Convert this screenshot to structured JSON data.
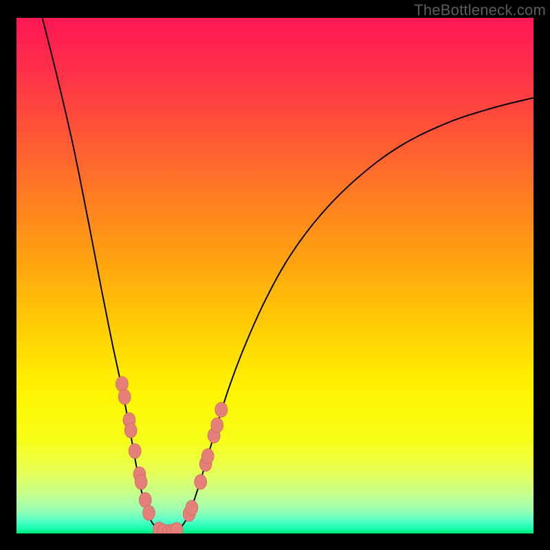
{
  "watermark": "TheBottleneck.com",
  "colors": {
    "frame": "#000000",
    "gradient_stops": [
      {
        "offset": 0.0,
        "color": "#ff1754"
      },
      {
        "offset": 0.1,
        "color": "#ff2f4a"
      },
      {
        "offset": 0.22,
        "color": "#ff5436"
      },
      {
        "offset": 0.35,
        "color": "#ff7e22"
      },
      {
        "offset": 0.48,
        "color": "#ffa60e"
      },
      {
        "offset": 0.6,
        "color": "#ffce04"
      },
      {
        "offset": 0.72,
        "color": "#fff300"
      },
      {
        "offset": 0.82,
        "color": "#f7ff18"
      },
      {
        "offset": 0.88,
        "color": "#e6ff55"
      },
      {
        "offset": 0.92,
        "color": "#c9ff8a"
      },
      {
        "offset": 0.955,
        "color": "#9affb2"
      },
      {
        "offset": 0.975,
        "color": "#58ffc9"
      },
      {
        "offset": 0.99,
        "color": "#18ffb0"
      },
      {
        "offset": 1.0,
        "color": "#00e876"
      }
    ],
    "curve": "#000000",
    "marker_fill": "#e48079",
    "marker_stroke": "#c95e56"
  },
  "chart_data": {
    "type": "line",
    "title": "",
    "xlabel": "",
    "ylabel": "",
    "xlim": [
      0,
      100
    ],
    "ylim": [
      0,
      100
    ],
    "grid": false,
    "legend": false,
    "note": "V-shaped bottleneck curve. Axis values are normalized 0–100 read off the plotting area; original axes are unlabeled.",
    "series": [
      {
        "name": "bottleneck-curve",
        "points": [
          {
            "x": 5.0,
            "y": 100.0
          },
          {
            "x": 8.0,
            "y": 88.0
          },
          {
            "x": 11.0,
            "y": 75.0
          },
          {
            "x": 14.0,
            "y": 60.0
          },
          {
            "x": 16.5,
            "y": 47.0
          },
          {
            "x": 18.5,
            "y": 37.0
          },
          {
            "x": 20.0,
            "y": 30.0
          },
          {
            "x": 21.2,
            "y": 24.0
          },
          {
            "x": 22.3,
            "y": 18.0
          },
          {
            "x": 23.2,
            "y": 13.0
          },
          {
            "x": 24.0,
            "y": 9.0
          },
          {
            "x": 25.0,
            "y": 5.0
          },
          {
            "x": 26.0,
            "y": 2.5
          },
          {
            "x": 27.2,
            "y": 1.0
          },
          {
            "x": 28.6,
            "y": 0.3
          },
          {
            "x": 30.2,
            "y": 0.3
          },
          {
            "x": 31.6,
            "y": 1.0
          },
          {
            "x": 33.0,
            "y": 3.0
          },
          {
            "x": 34.2,
            "y": 6.0
          },
          {
            "x": 35.5,
            "y": 10.0
          },
          {
            "x": 37.0,
            "y": 15.0
          },
          {
            "x": 38.8,
            "y": 21.0
          },
          {
            "x": 41.0,
            "y": 28.0
          },
          {
            "x": 44.0,
            "y": 36.0
          },
          {
            "x": 48.0,
            "y": 45.0
          },
          {
            "x": 53.0,
            "y": 54.0
          },
          {
            "x": 59.0,
            "y": 62.0
          },
          {
            "x": 66.0,
            "y": 69.0
          },
          {
            "x": 74.0,
            "y": 75.0
          },
          {
            "x": 83.0,
            "y": 79.5
          },
          {
            "x": 92.0,
            "y": 82.5
          },
          {
            "x": 100.0,
            "y": 84.5
          }
        ]
      }
    ],
    "markers": {
      "name": "highlighted-points",
      "note": "Salmon dots clustered near the V trough and lower arms.",
      "points": [
        {
          "x": 20.4,
          "y": 29.0
        },
        {
          "x": 20.9,
          "y": 26.5
        },
        {
          "x": 21.8,
          "y": 22.0
        },
        {
          "x": 22.1,
          "y": 20.0
        },
        {
          "x": 22.9,
          "y": 16.0
        },
        {
          "x": 23.8,
          "y": 11.5
        },
        {
          "x": 24.1,
          "y": 10.0
        },
        {
          "x": 24.9,
          "y": 6.5
        },
        {
          "x": 25.6,
          "y": 4.0
        },
        {
          "x": 27.6,
          "y": 0.8
        },
        {
          "x": 28.4,
          "y": 0.4
        },
        {
          "x": 29.4,
          "y": 0.3
        },
        {
          "x": 30.2,
          "y": 0.4
        },
        {
          "x": 31.0,
          "y": 0.7
        },
        {
          "x": 33.4,
          "y": 3.8
        },
        {
          "x": 33.9,
          "y": 5.0
        },
        {
          "x": 35.6,
          "y": 10.0
        },
        {
          "x": 36.6,
          "y": 13.5
        },
        {
          "x": 37.0,
          "y": 15.0
        },
        {
          "x": 38.2,
          "y": 19.0
        },
        {
          "x": 38.8,
          "y": 21.0
        },
        {
          "x": 39.6,
          "y": 24.0
        }
      ]
    }
  }
}
